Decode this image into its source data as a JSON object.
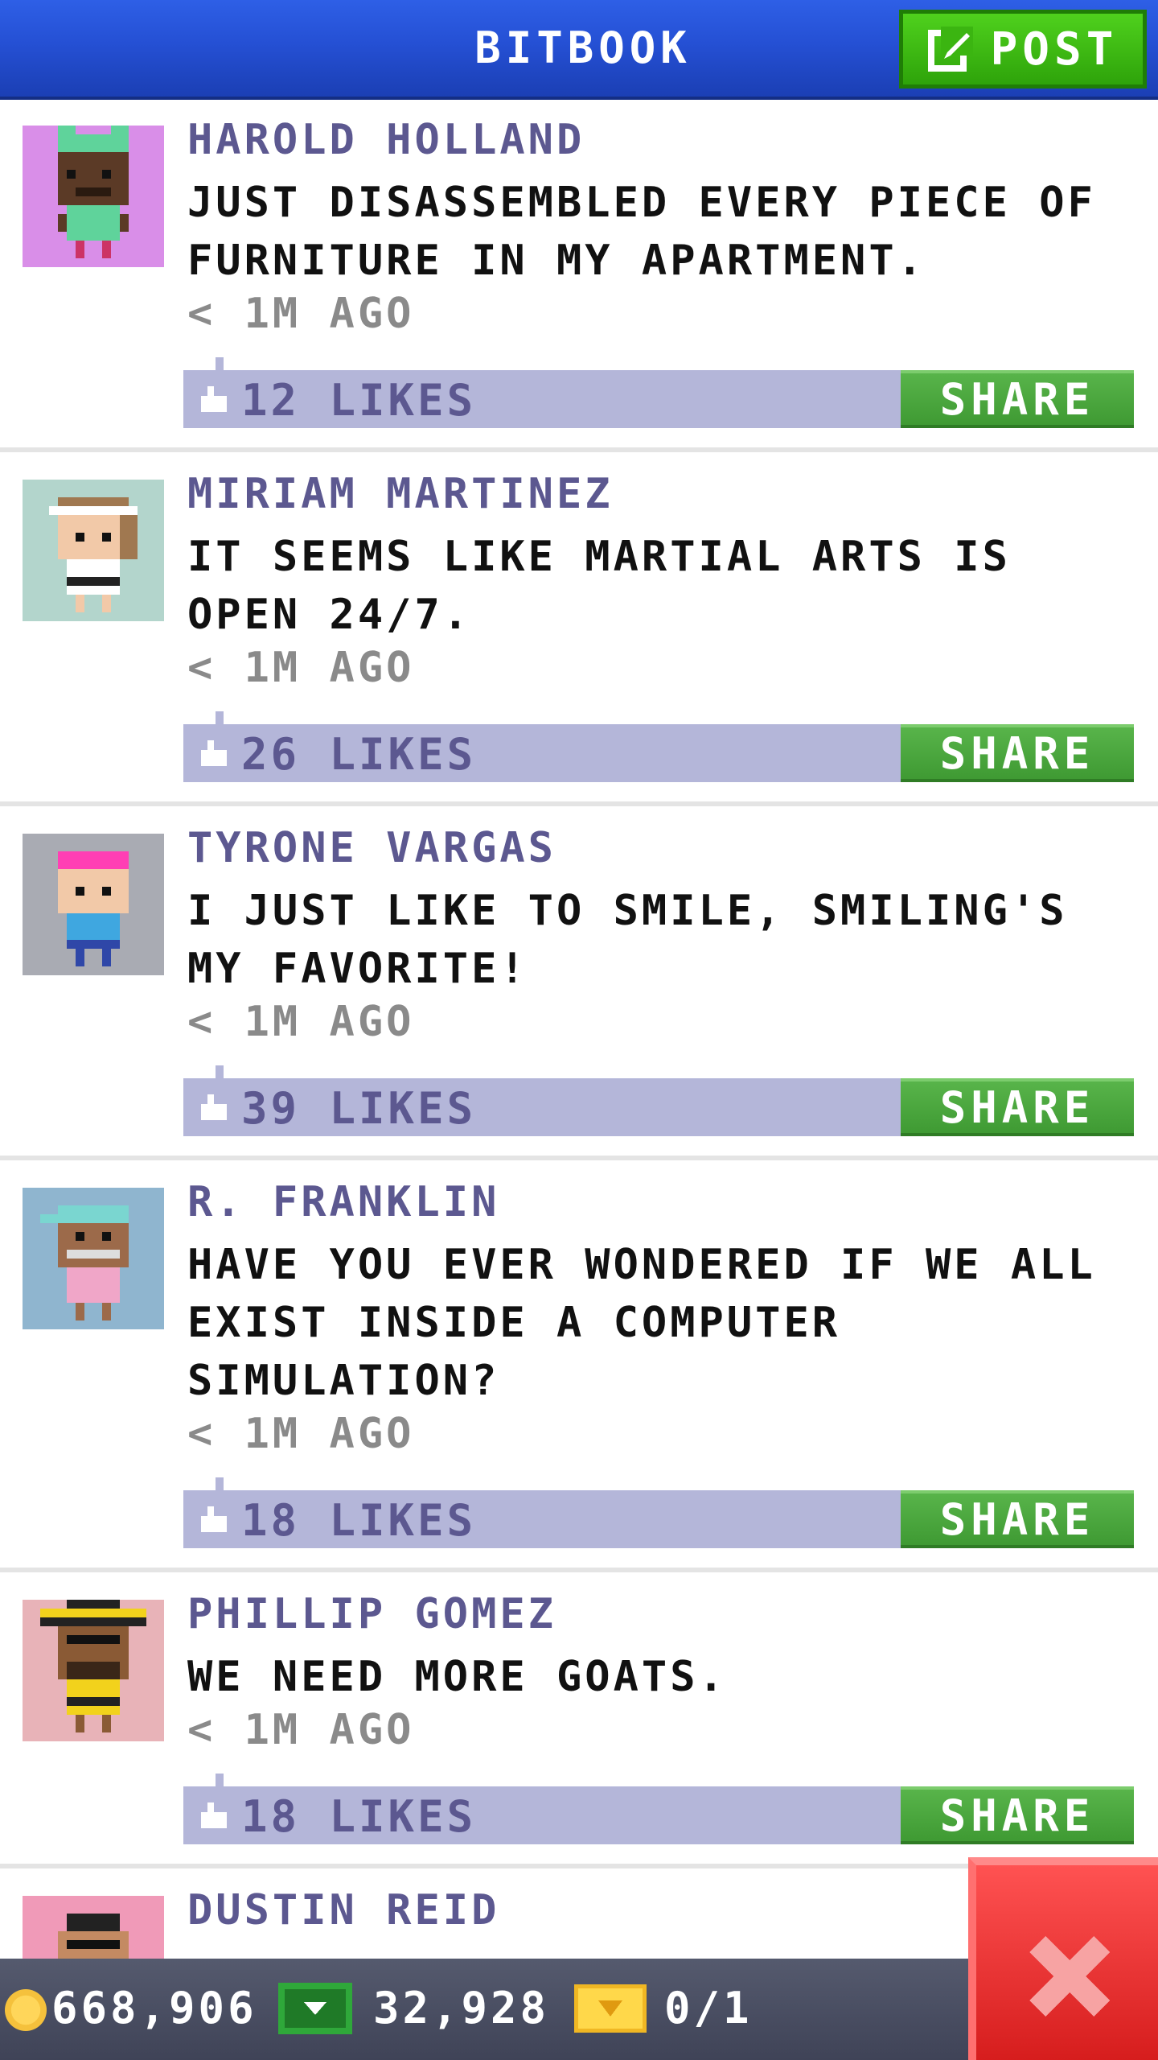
{
  "header": {
    "title": "BITBOOK",
    "post_label": "POST"
  },
  "posts": [
    {
      "author": "HAROLD HOLLAND",
      "message": "JUST DISASSEMBLED EVERY PIECE OF FURNITURE IN MY APARTMENT.",
      "time": "< 1M AGO",
      "likes": "12 LIKES",
      "share_label": "SHARE",
      "avatar_bg": "#d98ee8"
    },
    {
      "author": "MIRIAM MARTINEZ",
      "message": "IT SEEMS LIKE MARTIAL ARTS IS OPEN 24/7.",
      "time": "< 1M AGO",
      "likes": "26 LIKES",
      "share_label": "SHARE",
      "avatar_bg": "#b3d5cc"
    },
    {
      "author": "TYRONE VARGAS",
      "message": "I JUST LIKE TO SMILE, SMILING'S MY FAVORITE!",
      "time": "< 1M AGO",
      "likes": "39 LIKES",
      "share_label": "SHARE",
      "avatar_bg": "#a9abb3"
    },
    {
      "author": "R. FRANKLIN",
      "message": "HAVE YOU EVER WONDERED IF WE ALL EXIST INSIDE A COMPUTER SIMULATION?",
      "time": "< 1M AGO",
      "likes": "18 LIKES",
      "share_label": "SHARE",
      "avatar_bg": "#8fb5cf"
    },
    {
      "author": "PHILLIP GOMEZ",
      "message": "WE NEED MORE GOATS.",
      "time": "< 1M AGO",
      "likes": "18 LIKES",
      "share_label": "SHARE",
      "avatar_bg": "#e8b3b8"
    },
    {
      "author": "DUSTIN REID",
      "message": "",
      "time": "",
      "likes": "",
      "share_label": "",
      "avatar_bg": "#f09ab8"
    }
  ],
  "bottom_bar": {
    "coins": "668,906",
    "bux": "32,928",
    "tickets": "0/1"
  },
  "colors": {
    "header_blue": "#2550d4",
    "post_green": "#3bb511",
    "share_green": "#4ea842",
    "like_bar": "#b4b6d9",
    "author_purple": "#5c5890",
    "close_red": "#e83030"
  },
  "icons": [
    "compose-icon",
    "thumbs-up-icon",
    "coin-icon",
    "bux-icon",
    "ticket-icon",
    "close-icon"
  ]
}
